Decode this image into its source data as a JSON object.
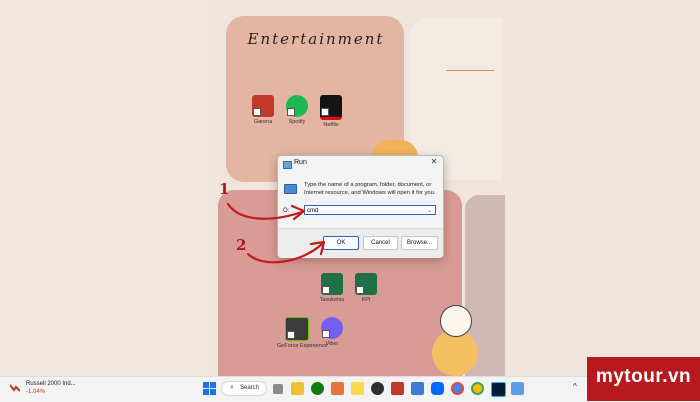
{
  "desktop": {
    "panel_title": "Entertainment",
    "icons": [
      {
        "label": "Garena",
        "color": "#c0392b"
      },
      {
        "label": "Spotify",
        "color": "#1db954"
      },
      {
        "label": "Netflix",
        "color": "#e50914"
      },
      {
        "label": "Tasuketsu",
        "color": "#1e7145"
      },
      {
        "label": "KPI",
        "color": "#1e7145"
      },
      {
        "label": "GeForce Experience",
        "color": "#3b3b3b"
      },
      {
        "label": "Viber",
        "color": "#7360f2"
      }
    ]
  },
  "run_dialog": {
    "title": "Run",
    "close_glyph": "✕",
    "description": "Type the name of a program, folder, document, or Internet resource, and Windows will open it for you.",
    "open_label": "O:",
    "input_value": "cmd",
    "dropdown_glyph": "⌄",
    "ok_label": "OK",
    "cancel_label": "Cancel",
    "browse_label": "Browse..."
  },
  "annotations": {
    "step1": "1",
    "step2": "2",
    "arrow_color": "#c41a1f"
  },
  "taskbar": {
    "widget_title": "Russell 2000 Ind...",
    "widget_change": "-1.04%",
    "search_label": "Search",
    "search_icon": "⌕",
    "tray_chevron": "^",
    "apps": [
      {
        "name": "file-explorer-icon",
        "color": "#f2c037"
      },
      {
        "name": "xbox-icon",
        "color": "#107c10"
      },
      {
        "name": "office-icon",
        "color": "#e8743b"
      },
      {
        "name": "sticky-notes-icon",
        "color": "#f7d94c"
      },
      {
        "name": "obs-icon",
        "color": "#302e31"
      },
      {
        "name": "garena-icon",
        "color": "#c0392b"
      },
      {
        "name": "app-icon",
        "color": "#3a7bd5"
      },
      {
        "name": "zalo-icon",
        "color": "#0068ff"
      },
      {
        "name": "chrome-icon",
        "color": "#4285f4"
      },
      {
        "name": "chrome-alt-icon",
        "color": "#e24a3b"
      },
      {
        "name": "photoshop-icon",
        "color": "#001e36"
      },
      {
        "name": "run-icon",
        "color": "#5aa0e6"
      }
    ]
  },
  "brand": {
    "text": "mytour.vn",
    "color": "#b8191e"
  }
}
